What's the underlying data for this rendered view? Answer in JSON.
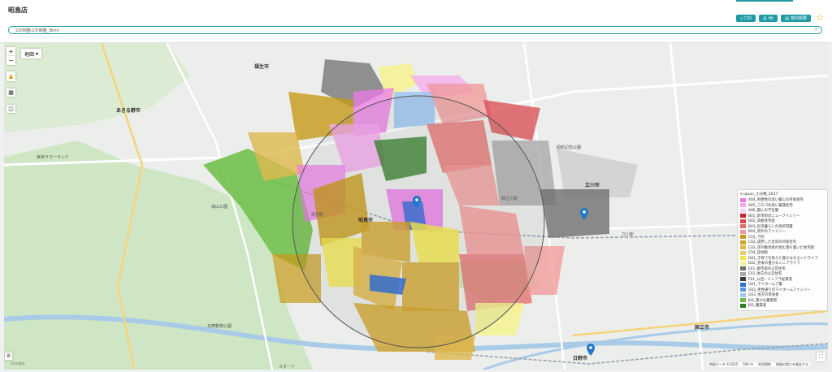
{
  "page": {
    "title": "昭島店"
  },
  "toolbar": {
    "buttons": [
      {
        "label": "CSV",
        "icon": "download-icon"
      },
      {
        "label": "Hb",
        "icon": "print-icon"
      },
      {
        "label": "物件概要",
        "icon": "document-icon"
      }
    ],
    "favorite_icon": "star-icon"
  },
  "search": {
    "value": "2次商圏(2次商圏_3km)"
  },
  "map": {
    "type_label": "地図",
    "controls": {
      "zoom_in": "+",
      "zoom_out": "−",
      "fullscreen": "⛶"
    },
    "place_labels": {
      "fussa": "福生市",
      "akiruno": "あきる野市",
      "akishima": "昭島市",
      "tachikawa": "立川市",
      "kunitachi": "国立市",
      "hino": "日野市",
      "haijima": "拝島駅",
      "nishitachikawa": "西立川駅",
      "tachikawa_sta": "立川駅",
      "shiroyama": "城山公園",
      "tokyo_summerland": "東京サマーランド",
      "showa_kinen": "昭和記念公園",
      "tama_dobutsu": "多摩動物公園",
      "start": "スタート"
    },
    "attribution": [
      "地図データ ©2025",
      "500 m",
      "利用規約",
      "地図の誤りを報告する"
    ],
    "google": "Google"
  },
  "legend": {
    "title": "e-japan_小分類_2017",
    "items": [
      {
        "label": "A04_利便性の高い都心の持家住宅",
        "color": "#ee7ae8"
      },
      {
        "label": "A05_コスパの高い賃貸住宅",
        "color": "#f5a8ee"
      },
      {
        "label": "A06_都心の学生層",
        "color": "#fbd2f7"
      },
      {
        "label": "B01_新市街のニューファミリー",
        "color": "#c8232b"
      },
      {
        "label": "B02_高級住宅街",
        "color": "#d9474f"
      },
      {
        "label": "B03_近郊暮らしの高所得層",
        "color": "#e56b6b"
      },
      {
        "label": "B04_郊外のファミリー",
        "color": "#f29797"
      },
      {
        "label": "C01_下町",
        "color": "#c79a18"
      },
      {
        "label": "C02_成熟した近郊の持家住宅",
        "color": "#d3a52b"
      },
      {
        "label": "C03_郊外勤労者の住む落ち着いた住宅街",
        "color": "#dfb84e"
      },
      {
        "label": "C04_団地街",
        "color": "#e9cd72"
      },
      {
        "label": "D01_子育てを終えた豊かなセカンドライフ",
        "color": "#f2e84f"
      },
      {
        "label": "D02_老後の豊かなシニアライフ",
        "color": "#f7f28f"
      },
      {
        "label": "E01_都市部の公営住宅",
        "color": "#6f6f6f"
      },
      {
        "label": "E02_地方の公営住宅",
        "color": "#a9a9a9"
      },
      {
        "label": "F01_公団・インフラ従業者",
        "color": "#3a3a3a"
      },
      {
        "label": "G01_マイホームア層",
        "color": "#2f6fd6"
      },
      {
        "label": "G02_男性通りのマイホームファミリー",
        "color": "#5b9ae8"
      },
      {
        "label": "G03_地方の単身者",
        "color": "#9fc7f3"
      },
      {
        "label": "J04_豊かな農業者",
        "color": "#6bbd45"
      },
      {
        "label": "J05_農業者",
        "color": "#2f7d24"
      }
    ]
  }
}
